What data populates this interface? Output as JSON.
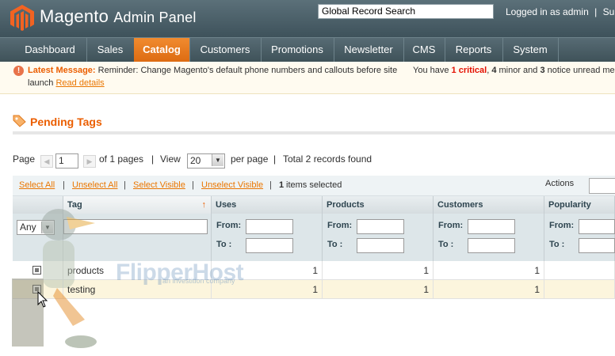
{
  "header": {
    "brand": "Magento",
    "product": "Admin Panel",
    "search_value": "Global Record Search",
    "login_text": "Logged in as admin",
    "login_sep": "|",
    "login_trailing": "Sunda"
  },
  "nav": {
    "items": [
      {
        "label": "Dashboard",
        "active": false
      },
      {
        "label": "Sales",
        "active": false
      },
      {
        "label": "Catalog",
        "active": true
      },
      {
        "label": "Customers",
        "active": false
      },
      {
        "label": "Promotions",
        "active": false
      },
      {
        "label": "Newsletter",
        "active": false
      },
      {
        "label": "CMS",
        "active": false
      },
      {
        "label": "Reports",
        "active": false
      },
      {
        "label": "System",
        "active": false
      }
    ]
  },
  "notice": {
    "title": "Latest Message:",
    "text_line1": "Reminder: Change Magento's default phone numbers and callouts before site",
    "text_line2": "launch",
    "link": "Read details",
    "right_prefix": "You have",
    "critical_count": "1 critical",
    "right_mid1": ",",
    "minor_count": "4",
    "right_mid2": "minor and",
    "notice_count": "3",
    "right_suffix": "notice unread mes"
  },
  "section": {
    "title": "Pending Tags",
    "icon": "tag-icon"
  },
  "pager": {
    "page_label": "Page",
    "page_value": "1",
    "of_pages": "of 1 pages",
    "sep": "|",
    "view_label": "View",
    "view_value": "20",
    "per_page": "per page",
    "total": "Total 2 records found"
  },
  "massaction": {
    "select_all": "Select All",
    "unselect_all": "Unselect All",
    "select_visible": "Select Visible",
    "unselect_visible": "Unselect Visible",
    "sep": "|",
    "selected_count": "1",
    "selected_suffix": "items selected",
    "actions_label": "Actions"
  },
  "grid": {
    "columns": [
      "Tag",
      "Uses",
      "Products",
      "Customers",
      "Popularity"
    ],
    "sort_indicator": "↑",
    "filter": {
      "any_value": "Any",
      "from_label": "From:",
      "to_label": "To :"
    },
    "rows": [
      {
        "tag": "products",
        "uses": "1",
        "products": "1",
        "customers": "1",
        "popularity": ""
      },
      {
        "tag": "testing",
        "uses": "1",
        "products": "1",
        "customers": "1",
        "popularity": ""
      }
    ]
  },
  "watermark": {
    "text": "FlipperHost",
    "sub": "an investition company"
  },
  "colors": {
    "accent": "#eb5e00",
    "nav_active": "#e8741d",
    "header_bg": "#4a5e66",
    "notice_bg": "#fffbf0"
  }
}
